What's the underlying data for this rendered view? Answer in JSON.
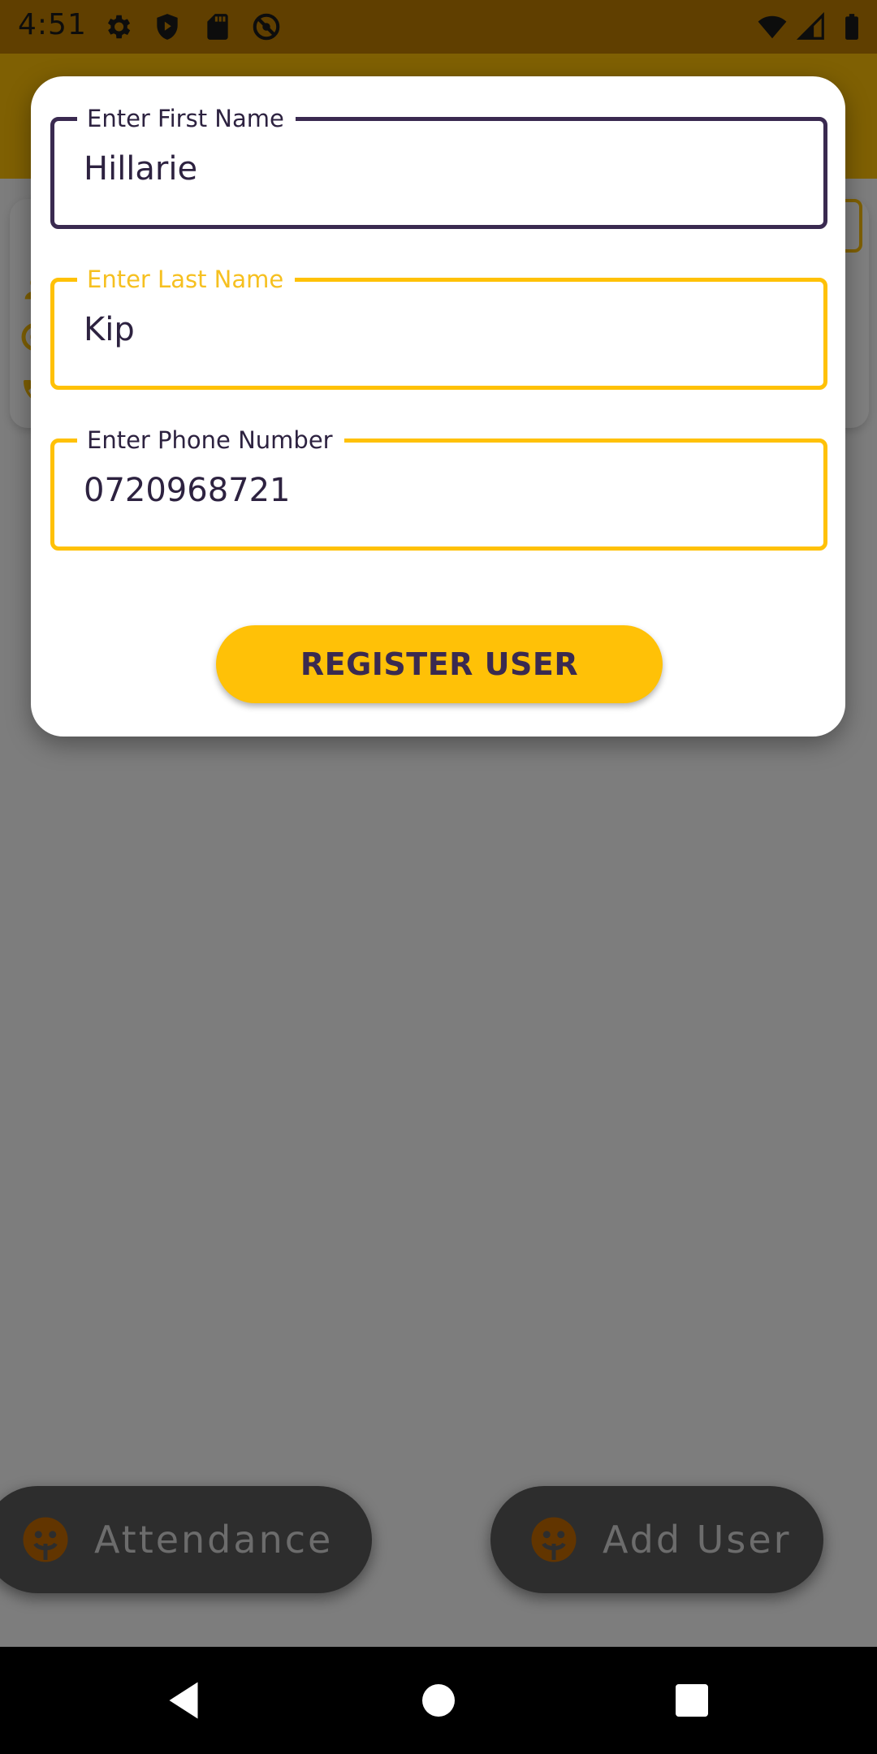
{
  "status_bar": {
    "time": "4:51",
    "icons": [
      "settings-icon",
      "shield-play-icon",
      "sd-card-icon",
      "no-disturb-icon",
      "wifi-icon",
      "cellular-icon",
      "battery-icon"
    ]
  },
  "dialog": {
    "fields": [
      {
        "label": "Enter First Name",
        "value": "Hillarie",
        "focused": true
      },
      {
        "label": "Enter Last Name",
        "value": "Kip"
      },
      {
        "label": "Enter Phone Number",
        "value": "0720968721"
      }
    ],
    "register_button": "REGISTER USER"
  },
  "fabs": {
    "attendance_label": "Attendance",
    "add_user_label": "Add User",
    "icon": "face-icon"
  },
  "colors": {
    "primary_yellow": "#ffc107",
    "dark_purple": "#3a2a50",
    "status_bar": "#c07f00"
  }
}
